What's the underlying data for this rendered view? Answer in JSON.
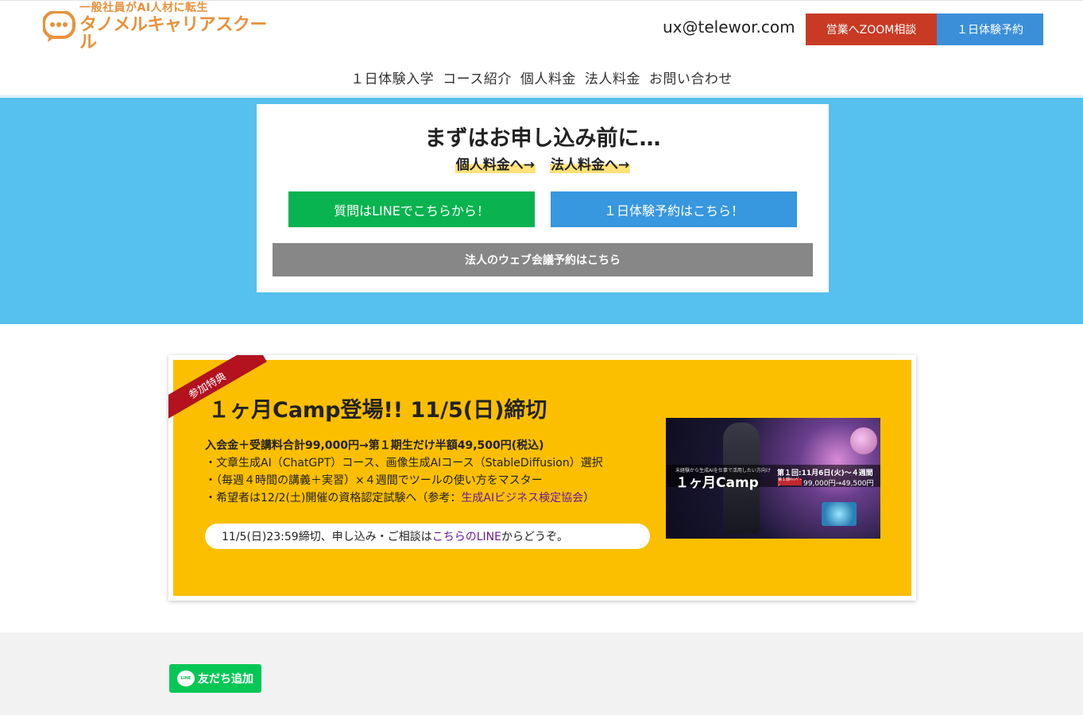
{
  "header": {
    "logo_sub": "一般社員がAI人材に転生",
    "logo_main": "タノメルキャリアスクール",
    "email": "ux@telewor.com",
    "zoom_button": "営業へZOOM相談",
    "trial_button": "１日体験予約"
  },
  "nav": {
    "items": [
      {
        "label": "１日体験入学"
      },
      {
        "label": "コース紹介"
      },
      {
        "label": "個人料金"
      },
      {
        "label": "法人料金"
      },
      {
        "label": "お問い合わせ"
      }
    ]
  },
  "hero": {
    "title": "まずはお申し込み前に…",
    "personal_link": "個人料金へ→",
    "corporate_link": "法人料金へ→",
    "line_button": "質問はLINEでこちらから！",
    "trial_button": "１日体験予約はこちら！",
    "corporate_meeting_button": "法人のウェブ会議予約はこちら"
  },
  "campaign": {
    "ribbon": "参加特典",
    "title": "１ヶ月Camp登場!! 11/5(日)締切",
    "line1": "入会金＋受講料合計99,000円→第１期生だけ半額49,500円(税込)",
    "line2": "・文章生成AI（ChatGPT）コース、画像生成AIコース（StableDiffusion）選択",
    "line3": "・（毎週４時間の講義＋実習）×４週間でツールの使い方をマスター",
    "line4_prefix": "・希望者は12/2(土)開催の資格認定試験へ（参考：",
    "line4_link": "生成AIビジネス検定協会",
    "line4_suffix": "）",
    "pill_prefix": "11/5(日)23:59締切、申し込み・ご相談は",
    "pill_link": "こちらのLINE",
    "pill_suffix": "からどうぞ。",
    "image": {
      "small_caption": "未経験から生成AIを仕事で活用したい方向け",
      "big_caption": "１ヶ月Camp",
      "right_caption": "第１回:11月6日(火)〜４週間",
      "badge": "第１期ｷｬﾝﾍﾟｰﾝ",
      "price": "99,000円→49,500円"
    }
  },
  "footer": {
    "line_badge": "LINE",
    "friend_button": "友だち追加"
  },
  "colors": {
    "hero_bg": "#56c0ee",
    "campaign_bg": "#fcbf00",
    "zoom_button": "#c93a25",
    "trial_button": "#3b8fd9",
    "line_green": "#09b350",
    "ribbon_red": "#b3121f",
    "logo_orange": "#e8913b"
  }
}
